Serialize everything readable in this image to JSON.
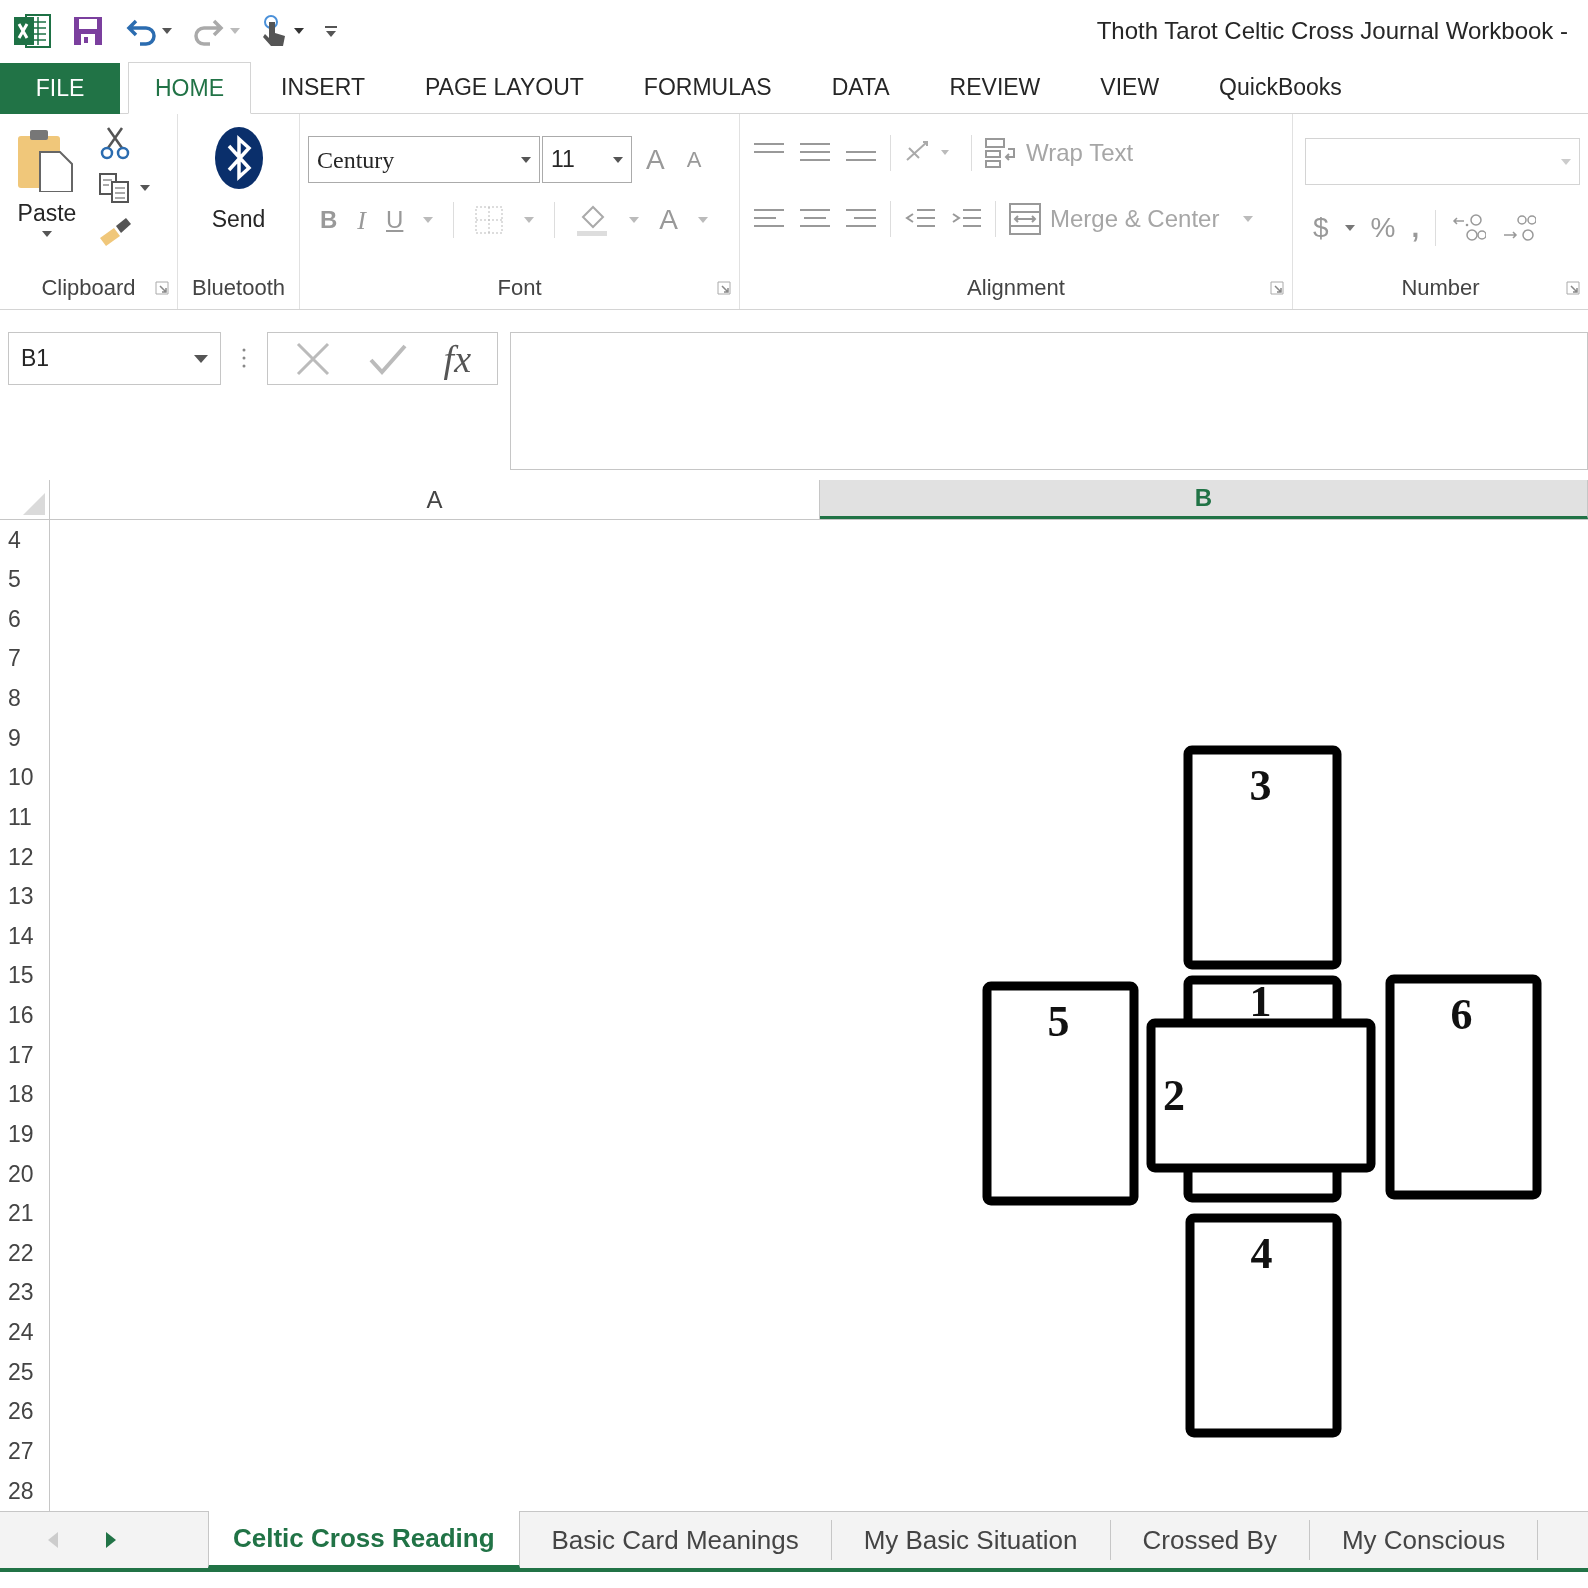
{
  "window": {
    "title": "Thoth Tarot Celtic Cross Journal Workbook -"
  },
  "ribbon_tabs": [
    {
      "label": "FILE",
      "kind": "file"
    },
    {
      "label": "HOME",
      "kind": "tab",
      "selected": true
    },
    {
      "label": "INSERT",
      "kind": "tab",
      "selected": false
    },
    {
      "label": "PAGE LAYOUT",
      "kind": "tab",
      "selected": false
    },
    {
      "label": "FORMULAS",
      "kind": "tab",
      "selected": false
    },
    {
      "label": "DATA",
      "kind": "tab",
      "selected": false
    },
    {
      "label": "REVIEW",
      "kind": "tab",
      "selected": false
    },
    {
      "label": "VIEW",
      "kind": "tab",
      "selected": false
    },
    {
      "label": "QuickBooks",
      "kind": "tab",
      "selected": false
    }
  ],
  "ribbon": {
    "clipboard": {
      "paste": "Paste",
      "group": "Clipboard"
    },
    "bluetooth": {
      "send": "Send",
      "group": "Bluetooth"
    },
    "font": {
      "font_name": "Century",
      "font_size": "11",
      "grow": "A",
      "shrink": "A",
      "bold": "B",
      "italic": "I",
      "underline": "U",
      "font_color": "A",
      "group": "Font"
    },
    "alignment": {
      "wrap_text": {
        "label": "Wrap Text",
        "disabled": true
      },
      "merge_center": {
        "label": "Merge & Center",
        "disabled": true
      },
      "group": "Alignment"
    },
    "number": {
      "currency": "$",
      "percent": "%",
      "comma": ",",
      "group": "Number"
    }
  },
  "formula_bar": {
    "name_box": "B1",
    "function_label": "fx"
  },
  "columns": [
    {
      "label": "A",
      "selected": false
    },
    {
      "label": "B",
      "selected": true
    }
  ],
  "rows": [
    "4",
    "5",
    "6",
    "7",
    "8",
    "9",
    "10",
    "11",
    "12",
    "13",
    "14",
    "15",
    "16",
    "17",
    "18",
    "19",
    "20",
    "21",
    "22",
    "23",
    "24",
    "25",
    "26",
    "27",
    "28"
  ],
  "cards": [
    {
      "label": "3",
      "kind": "upright"
    },
    {
      "label": "1",
      "kind": "upright"
    },
    {
      "label": "2",
      "kind": "crossing"
    },
    {
      "label": "5",
      "kind": "upright"
    },
    {
      "label": "6",
      "kind": "upright"
    },
    {
      "label": "4",
      "kind": "upright"
    }
  ],
  "sheet_tabs": [
    {
      "label": "Celtic Cross Reading",
      "selected": true
    },
    {
      "label": "Basic Card Meanings",
      "selected": false
    },
    {
      "label": "My Basic Situation",
      "selected": false
    },
    {
      "label": "Crossed By",
      "selected": false
    },
    {
      "label": "My Conscious",
      "selected": false
    }
  ]
}
